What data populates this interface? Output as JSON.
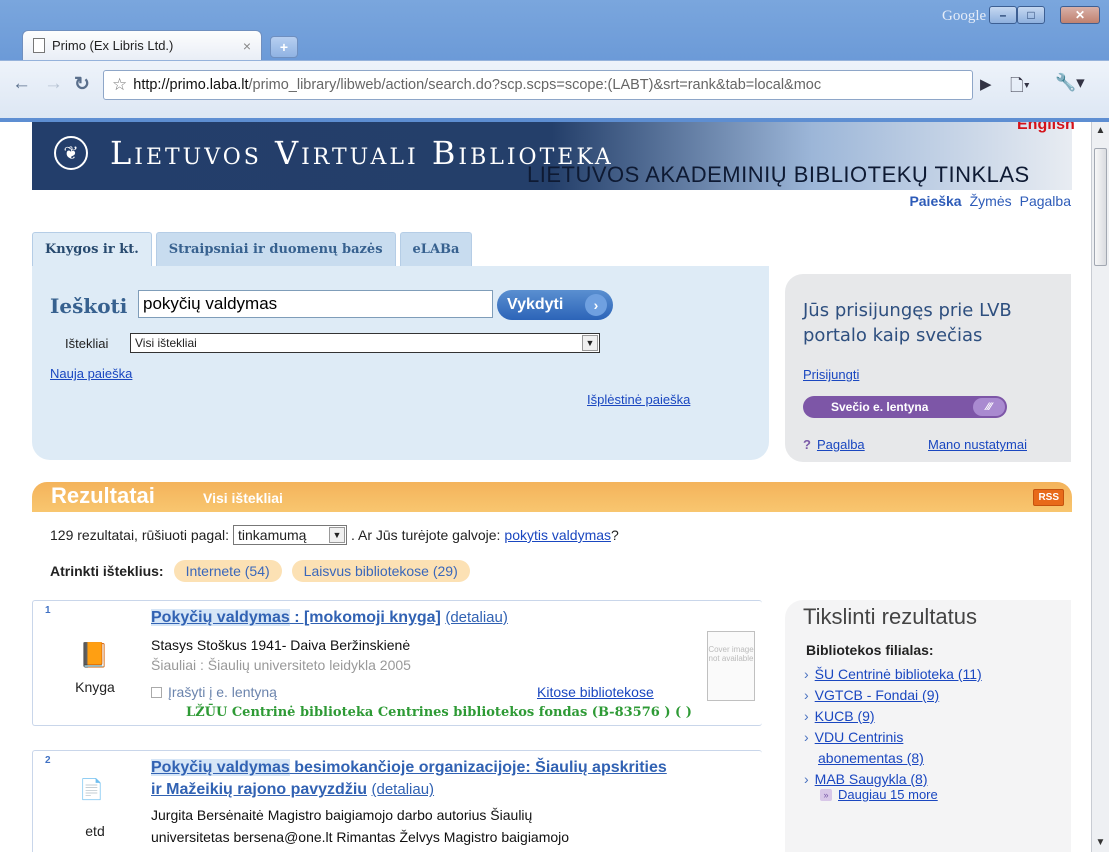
{
  "browser": {
    "tab_title": "Primo (Ex Libris Ltd.)",
    "tab_close": "×",
    "new_tab": "+",
    "google_label": "Google",
    "url_host": "http://primo.laba.lt",
    "url_path": "/primo_library/libweb/action/search.do?scp.scps=scope:(LABT)&srt=rank&tab=local&moc"
  },
  "banner": {
    "brand": "Lietuvos Virtuali Biblioteka",
    "network": "LIETUVOS AKADEMINIŲ BIBLIOTEKŲ TINKLAS",
    "language_link": "English"
  },
  "topnav": [
    "Paieška",
    "Žymės",
    "Pagalba"
  ],
  "search_tabs": [
    "Knygos ir kt.",
    "Straipsniai ir duomenų bazės",
    "eLABa"
  ],
  "search": {
    "label": "Ieškoti",
    "query": "pokyčių valdymas",
    "button": "Vykdyti",
    "sources_label": "Ištekliai",
    "sources_value": "Visi ištekliai",
    "new_search": "Nauja paieška",
    "advanced_search": "Išplėstinė paieška"
  },
  "guest": {
    "title": "Jūs prisijungęs prie LVB portalo kaip svečias",
    "login": "Prisijungti",
    "shelf": "Svečio e. lentyna",
    "help": "Pagalba",
    "settings": "Mano nustatymai"
  },
  "results": {
    "title": "Rezultatai",
    "scope": "Visi ištekliai",
    "rss": "RSS",
    "count_text": "129 rezultatai, rūšiuoti pagal:",
    "sort_value": "tinkamumą",
    "didyoumean_prefix": ". Ar Jūs turėjote galvoje:",
    "didyoumean_link": "pokytis valdymas",
    "didyoumean_suffix": "?",
    "filter_label": "Atrinkti išteklius:",
    "filters": [
      "Internete (54)",
      "Laisvus bibliotekose (29)"
    ]
  },
  "items": [
    {
      "num": "1",
      "type": "Knyga",
      "title_hl": "Pokyčių valdymas",
      "title_rest": " : [mokomoji knyga]",
      "detail": "(detaliau)",
      "authors": "Stasys Stoškus 1941- Daiva Beržinskienė",
      "publisher": "Šiauliai : Šiaulių universiteto leidykla 2005",
      "cover_text": "Cover image not available",
      "shelf": "Įrašyti į e. lentyną",
      "other_libraries": "Kitose bibliotekose",
      "holdings": "LŽŪU Centrinė biblioteka Centrines bibliotekos fondas (B-83576 ) ( )"
    },
    {
      "num": "2",
      "type": "etd",
      "title_hl": "Pokyčių valdymas",
      "title_rest": " besimokančioje organizacijoje: Šiaulių apskrities ir Mažeikių rajono pavyzdžiu",
      "detail": "(detaliau)",
      "line1": "Jurgita Bersėnaitė Magistro baigiamojo darbo autorius Šiaulių",
      "line2": "universitetas bersena@one.lt Rimantas Želvys Magistro baigiamojo"
    }
  ],
  "refine": {
    "title": "Tikslinti rezultatus",
    "facet": "Bibliotekos filialas:",
    "items": [
      "ŠU Centrinė biblioteka (11)",
      "VGTCB - Fondai (9)",
      "KUCB (9)",
      "VDU Centrinis",
      "abonementas (8)",
      "MAB Saugykla (8)"
    ],
    "more": "Daugiau 15 more"
  }
}
